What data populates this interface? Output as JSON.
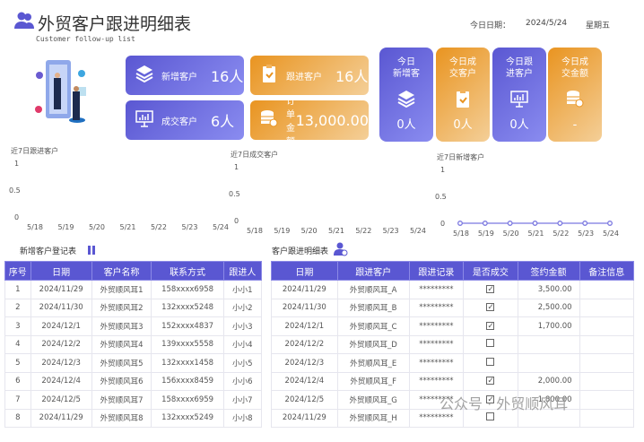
{
  "header": {
    "title": "外贸客户跟进明细表",
    "subtitle": "Customer follow-up list",
    "date_label": "今日日期：",
    "date": "2024/5/24",
    "weekday": "星期五"
  },
  "colors": {
    "blue": "#5a57d2",
    "orange": "#e99420"
  },
  "summary": [
    {
      "label": "新增客户",
      "value": "16人",
      "icon": "layers-icon",
      "color": "blue"
    },
    {
      "label": "跟进客户",
      "value": "16人",
      "icon": "clipboard-check-icon",
      "color": "orange"
    },
    {
      "label": "成交客户",
      "value": "6人",
      "icon": "monitor-chart-icon",
      "color": "blue"
    },
    {
      "label": "订单金额",
      "value": "13,000.00",
      "icon": "coins-icon",
      "color": "orange"
    }
  ],
  "today": [
    {
      "label1": "今日",
      "label2": "新增客",
      "value": "0人",
      "icon": "layers-icon",
      "color": "blue"
    },
    {
      "label1": "今日成",
      "label2": "交客户",
      "value": "0人",
      "icon": "clipboard-check-icon",
      "color": "orange"
    },
    {
      "label1": "今日跟",
      "label2": "进客户",
      "value": "0人",
      "icon": "monitor-chart-icon",
      "color": "blue"
    },
    {
      "label1": "今日成",
      "label2": "交金额",
      "value": "-",
      "icon": "coins-icon",
      "color": "orange"
    }
  ],
  "chart_data": [
    {
      "type": "line",
      "title": "近7日跟进客户",
      "categories": [
        "5/18",
        "5/19",
        "5/20",
        "5/21",
        "5/22",
        "5/23",
        "5/24"
      ],
      "values": [],
      "yticks": [
        "1",
        "0.5",
        "0"
      ],
      "ylim": [
        0,
        1
      ]
    },
    {
      "type": "line",
      "title": "近7日成交客户",
      "categories": [
        "5/18",
        "5/19",
        "5/20",
        "5/21",
        "5/22",
        "5/23",
        "5/24"
      ],
      "values": [],
      "yticks": [
        "1",
        "0.5",
        "0"
      ],
      "ylim": [
        0,
        1
      ]
    },
    {
      "type": "line",
      "title": "近7日新增客户",
      "categories": [
        "5/18",
        "5/19",
        "5/20",
        "5/21",
        "5/22",
        "5/23",
        "5/24"
      ],
      "values": [
        0,
        0,
        0,
        0,
        0,
        0,
        0
      ],
      "yticks": [
        "1",
        "0.5",
        "0"
      ],
      "ylim": [
        0,
        1
      ],
      "color": "#7b78e0"
    }
  ],
  "new_table": {
    "title": "新增客户登记表",
    "headers": [
      "序号",
      "日期",
      "客户名称",
      "联系方式",
      "跟进人"
    ],
    "rows": [
      [
        "1",
        "2024/11/29",
        "外贸顺风耳1",
        "158xxxx6958",
        "小小1"
      ],
      [
        "2",
        "2024/11/30",
        "外贸顺风耳2",
        "132xxxx5248",
        "小小2"
      ],
      [
        "3",
        "2024/12/1",
        "外贸顺风耳3",
        "152xxxx4837",
        "小小3"
      ],
      [
        "4",
        "2024/12/2",
        "外贸顺风耳4",
        "139xxxx5558",
        "小小4"
      ],
      [
        "5",
        "2024/12/3",
        "外贸顺风耳5",
        "132xxxx1458",
        "小小5"
      ],
      [
        "6",
        "2024/12/4",
        "外贸顺风耳6",
        "156xxxx8459",
        "小小6"
      ],
      [
        "7",
        "2024/12/5",
        "外贸顺风耳7",
        "158xxxx6959",
        "小小7"
      ],
      [
        "8",
        "2024/11/29",
        "外贸顺风耳8",
        "132xxxx5249",
        "小小8"
      ]
    ]
  },
  "follow_table": {
    "title": "客户跟进明细表",
    "headers": [
      "日期",
      "跟进客户",
      "跟进记录",
      "是否成交",
      "签约金额",
      "备注信息"
    ],
    "rows": [
      [
        "2024/11/29",
        "外贸顺风耳_A",
        "*********",
        true,
        "3,500.00",
        ""
      ],
      [
        "2024/11/30",
        "外贸顺风耳_B",
        "*********",
        true,
        "2,500.00",
        ""
      ],
      [
        "2024/12/1",
        "外贸顺风耳_C",
        "*********",
        true,
        "1,700.00",
        ""
      ],
      [
        "2024/12/2",
        "外贸顺风耳_D",
        "*********",
        false,
        "",
        ""
      ],
      [
        "2024/12/3",
        "外贸顺风耳_E",
        "*********",
        false,
        "",
        ""
      ],
      [
        "2024/12/4",
        "外贸顺风耳_F",
        "*********",
        true,
        "2,000.00",
        ""
      ],
      [
        "2024/12/5",
        "外贸顺风耳_G",
        "*********",
        true,
        "1,800.00",
        ""
      ],
      [
        "2024/11/29",
        "外贸顺风耳_H",
        "*********",
        false,
        "",
        ""
      ]
    ]
  },
  "watermark": "公众号 · 外贸顺风耳"
}
